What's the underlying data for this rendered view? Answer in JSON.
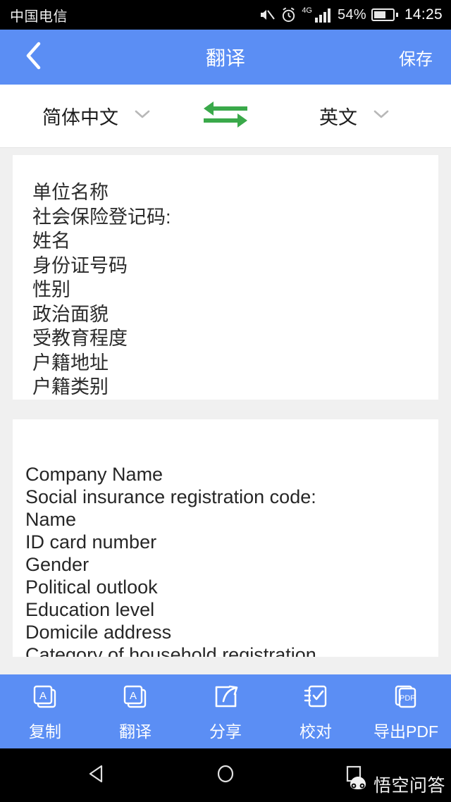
{
  "status_bar": {
    "carrier": "中国电信",
    "battery_percent": "54%",
    "time": "14:25",
    "network_type": "4G",
    "icons": [
      "mute-icon",
      "alarm-clock-icon",
      "signal-bars-icon",
      "battery-icon"
    ]
  },
  "header": {
    "back_icon": "chevron-left-icon",
    "title": "翻译",
    "save_label": "保存",
    "background_color": "#5b8ef4"
  },
  "language_bar": {
    "source_language": "简体中文",
    "target_language": "英文",
    "dropdown_icon": "chevron-down-icon",
    "swap_icon": "swap-horizontal-arrows-icon",
    "swap_color": "#3aa94a"
  },
  "source_card": {
    "lines": [
      "单位名称",
      "社会保险登记码:",
      "姓名",
      "身份证号码",
      "性别",
      "政治面貌",
      "受教育程度",
      "户籍地址",
      "户籍类别"
    ]
  },
  "target_card": {
    "lines": [
      "Company Name",
      "Social insurance registration code:",
      "Name",
      "ID card number",
      "Gender",
      "Political outlook",
      "Education level",
      "Domicile address",
      "Category of household registration"
    ]
  },
  "toolbar": {
    "items": [
      {
        "label": "复制",
        "icon": "copy-pages-a-icon"
      },
      {
        "label": "翻译",
        "icon": "translate-pages-a-icon"
      },
      {
        "label": "分享",
        "icon": "share-arrow-icon"
      },
      {
        "label": "校对",
        "icon": "proofread-checklist-icon"
      },
      {
        "label": "导出PDF",
        "icon": "export-pdf-icon"
      }
    ]
  },
  "nav_bar": {
    "back_icon": "triangle-back-icon",
    "home_icon": "circle-home-icon",
    "recents_icon": "square-recents-icon",
    "watermark_text": "悟空问答",
    "watermark_icon": "wukong-logo-icon"
  }
}
